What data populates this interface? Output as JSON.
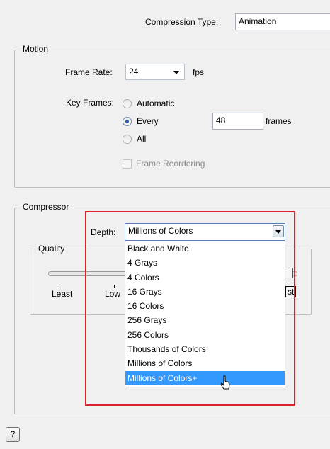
{
  "compression": {
    "label": "Compression Type:",
    "value": "Animation"
  },
  "motion": {
    "title": "Motion",
    "frame_rate_label": "Frame Rate:",
    "frame_rate_value": "24",
    "fps_label": "fps",
    "key_frames_label": "Key Frames:",
    "options": [
      "Automatic",
      "Every",
      "All"
    ],
    "selected_option": "Every",
    "every_value": "48",
    "frames_label": "frames",
    "frame_reordering_label": "Frame Reordering",
    "frame_reordering_checked": false
  },
  "compressor": {
    "title": "Compressor",
    "depth_label": "Depth:",
    "depth_value": "Millions of Colors",
    "depth_options": [
      "Black and White",
      "4 Grays",
      "4 Colors",
      "16 Grays",
      "16 Colors",
      "256 Grays",
      "256 Colors",
      "Thousands of Colors",
      "Millions of Colors",
      "Millions of Colors+"
    ],
    "highlighted_option": "Millions of Colors+",
    "quality_title": "Quality",
    "quality_least": "Least",
    "quality_low": "Low",
    "quality_best_partial": "st"
  },
  "help_label": "?",
  "colors": {
    "highlight": "#3399ff",
    "annotation_border": "#d9242b"
  }
}
